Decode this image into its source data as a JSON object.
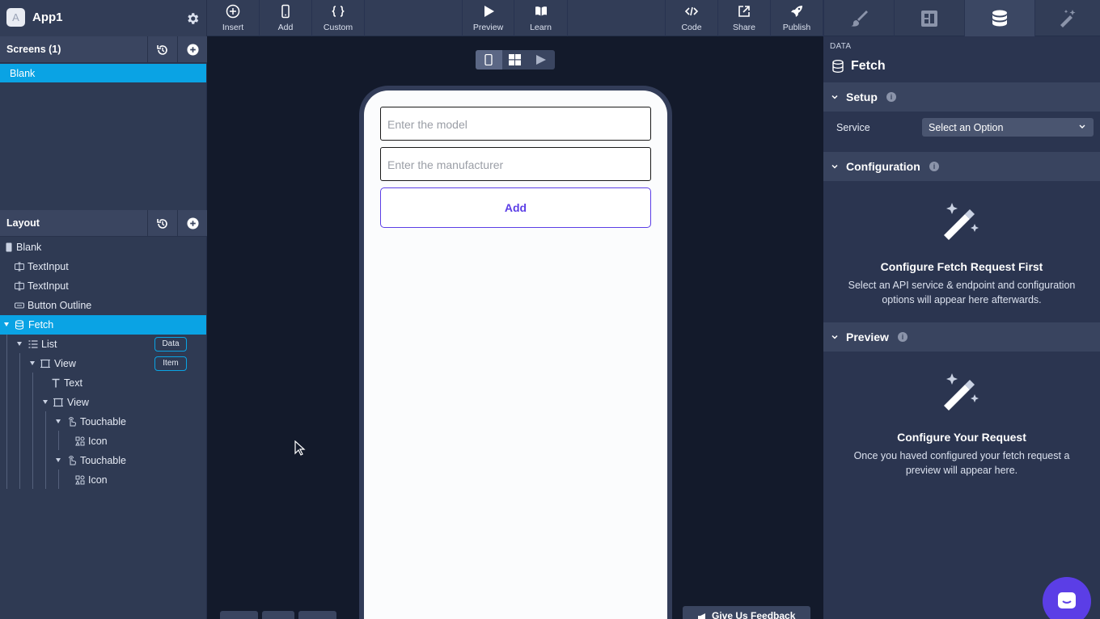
{
  "app": {
    "name": "App1"
  },
  "toolbar": {
    "insert": "Insert",
    "add": "Add",
    "custom": "Custom",
    "preview": "Preview",
    "learn": "Learn",
    "code": "Code",
    "share": "Share",
    "publish": "Publish"
  },
  "screens": {
    "title": "Screens (1)",
    "items": [
      "Blank"
    ]
  },
  "layout": {
    "title": "Layout",
    "tree": [
      {
        "label": "Blank"
      },
      {
        "label": "TextInput"
      },
      {
        "label": "TextInput"
      },
      {
        "label": "Button Outline"
      },
      {
        "label": "Fetch"
      },
      {
        "label": "List",
        "badge": "Data"
      },
      {
        "label": "View",
        "badge": "Item"
      },
      {
        "label": "Text"
      },
      {
        "label": "View"
      },
      {
        "label": "Touchable"
      },
      {
        "label": "Icon"
      },
      {
        "label": "Touchable"
      },
      {
        "label": "Icon"
      }
    ]
  },
  "canvas": {
    "model_placeholder": "Enter the model",
    "manufacturer_placeholder": "Enter the manufacturer",
    "add_button": "Add",
    "feedback": "Give Us Feedback"
  },
  "panel": {
    "crumb": "DATA",
    "title": "Fetch",
    "setup": {
      "title": "Setup",
      "service_label": "Service",
      "service_value": "Select an Option"
    },
    "configuration": {
      "title": "Configuration",
      "heading": "Configure Fetch Request First",
      "body": "Select an API service & endpoint and configuration options will appear here afterwards."
    },
    "preview": {
      "title": "Preview",
      "heading": "Configure Your Request",
      "body": "Once you haved configured your fetch request a preview will appear here."
    }
  }
}
